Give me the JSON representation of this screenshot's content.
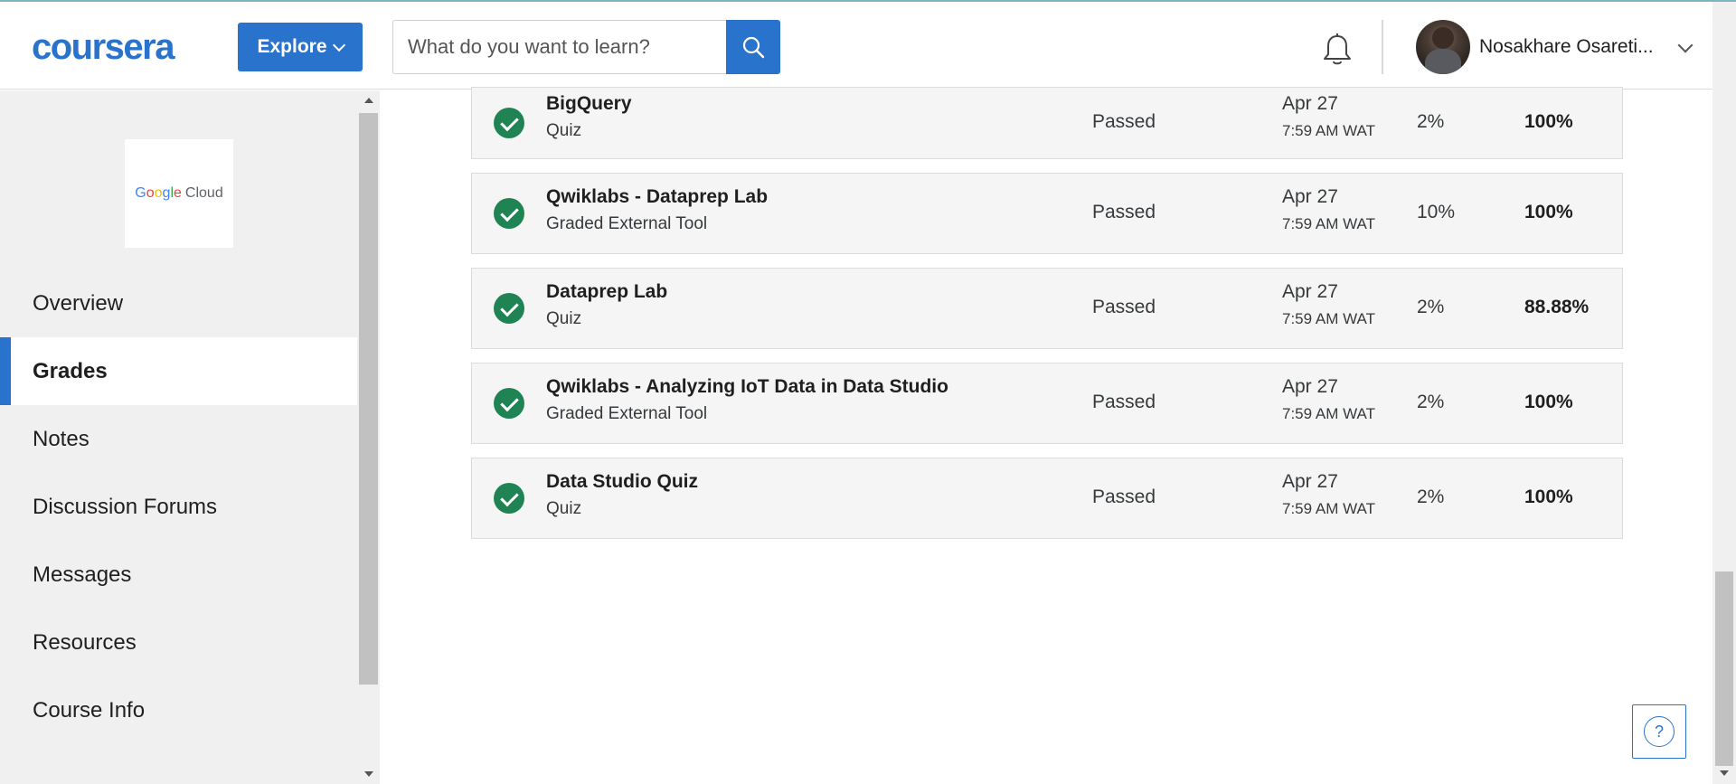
{
  "header": {
    "logo_text": "coursera",
    "explore_label": "Explore",
    "search_placeholder": "What do you want to learn?",
    "user_name": "Nosakhare Osareti..."
  },
  "sidebar": {
    "partner_logo": {
      "google": [
        "G",
        "o",
        "o",
        "g",
        "l",
        "e"
      ],
      "cloud": "Cloud"
    },
    "items": [
      {
        "label": "Overview",
        "active": false
      },
      {
        "label": "Grades",
        "active": true
      },
      {
        "label": "Notes",
        "active": false
      },
      {
        "label": "Discussion Forums",
        "active": false
      },
      {
        "label": "Messages",
        "active": false
      },
      {
        "label": "Resources",
        "active": false
      },
      {
        "label": "Course Info",
        "active": false
      }
    ]
  },
  "grades": [
    {
      "title": "BigQuery",
      "type": "Quiz",
      "status": "Passed",
      "date": "Apr 27",
      "time": "7:59 AM WAT",
      "weight": "2%",
      "grade": "100%"
    },
    {
      "title": "Qwiklabs - Dataprep Lab",
      "type": "Graded External Tool",
      "status": "Passed",
      "date": "Apr 27",
      "time": "7:59 AM WAT",
      "weight": "10%",
      "grade": "100%"
    },
    {
      "title": "Dataprep Lab",
      "type": "Quiz",
      "status": "Passed",
      "date": "Apr 27",
      "time": "7:59 AM WAT",
      "weight": "2%",
      "grade": "88.88%"
    },
    {
      "title": "Qwiklabs - Analyzing IoT Data in Data Studio",
      "type": "Graded External Tool",
      "status": "Passed",
      "date": "Apr 27",
      "time": "7:59 AM WAT",
      "weight": "2%",
      "grade": "100%"
    },
    {
      "title": "Data Studio Quiz",
      "type": "Quiz",
      "status": "Passed",
      "date": "Apr 27",
      "time": "7:59 AM WAT",
      "weight": "2%",
      "grade": "100%"
    }
  ],
  "help": {
    "label": "?"
  },
  "colors": {
    "brand_blue": "#2a73cc",
    "passed_green": "#1f8354",
    "sidebar_bg": "#f0f0f0",
    "row_bg": "#f5f5f5"
  },
  "icons": {
    "search": "search-icon",
    "bell": "bell-icon",
    "check": "check-circle-icon",
    "help": "help-icon"
  }
}
